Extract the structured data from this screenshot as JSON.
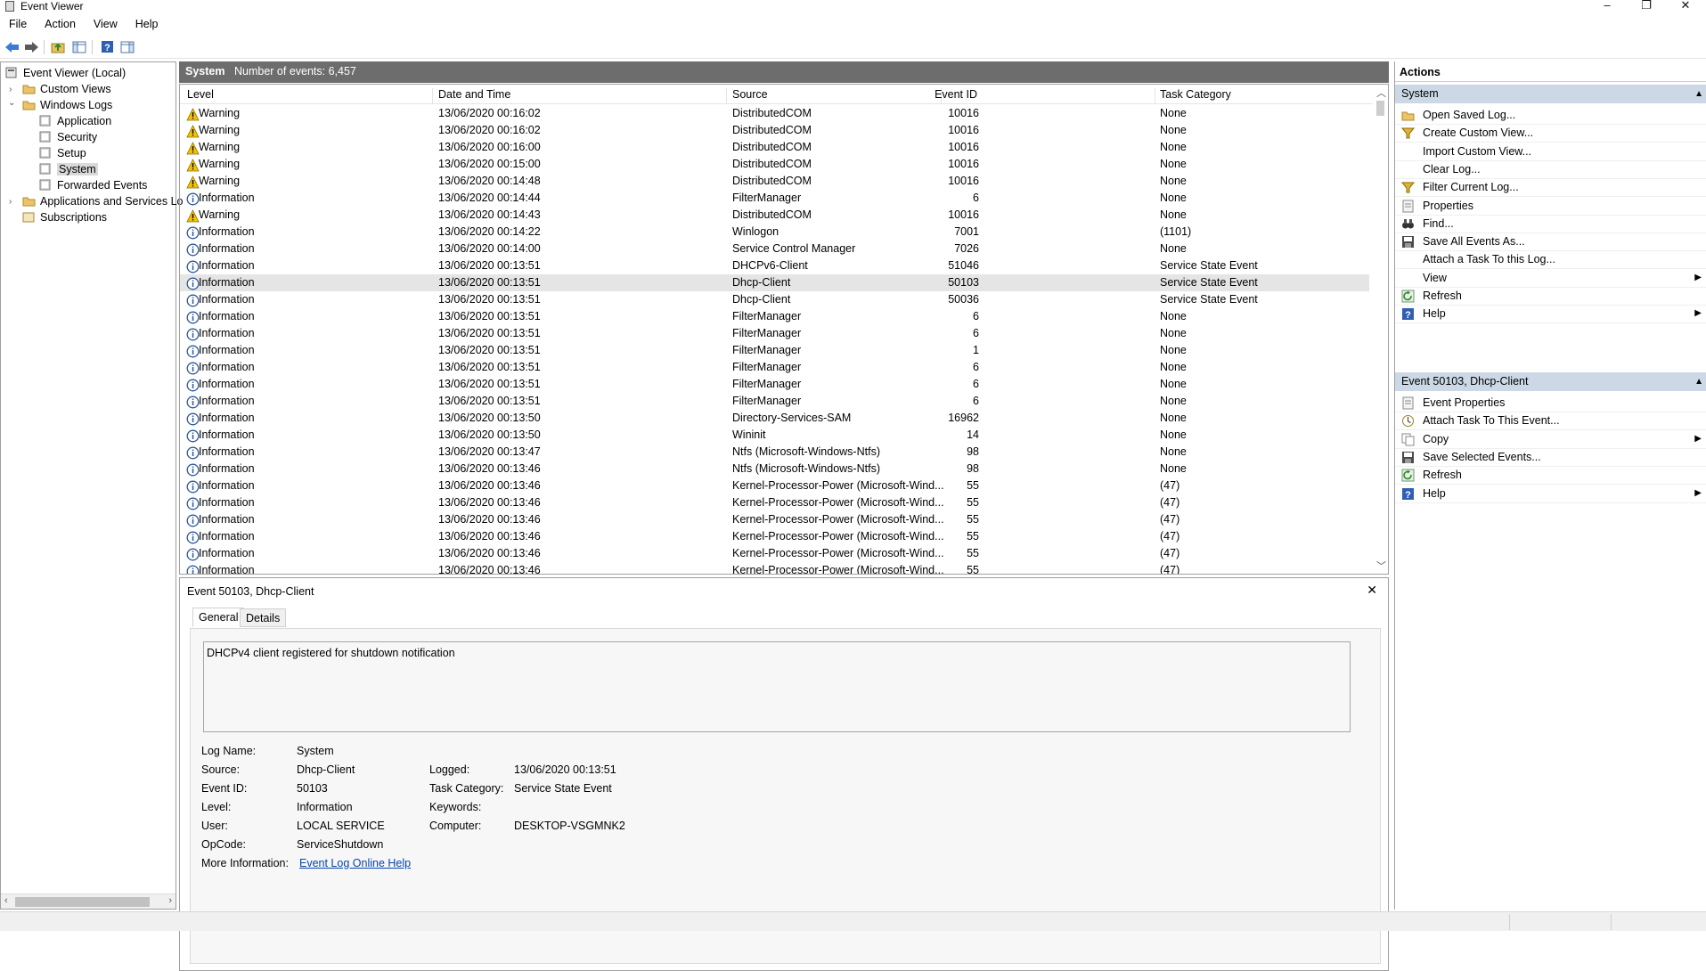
{
  "window": {
    "title": "Event Viewer",
    "minimize": "–",
    "restore": "❐",
    "close": "✕"
  },
  "menu": [
    "File",
    "Action",
    "View",
    "Help"
  ],
  "toolbar": [
    "back-icon",
    "forward-icon",
    "up-folder-icon",
    "show-hide-tree-icon",
    "help-icon",
    "show-hide-action-pane-icon"
  ],
  "tree": {
    "root": "Event Viewer (Local)",
    "custom_views": "Custom Views",
    "windows_logs": "Windows Logs",
    "logs": [
      "Application",
      "Security",
      "Setup",
      "System",
      "Forwarded Events"
    ],
    "apps_services": "Applications and Services Lo",
    "subscriptions": "Subscriptions",
    "selected": "System"
  },
  "center": {
    "log_name": "System",
    "event_count": "Number of events: 6,457",
    "columns": [
      "Level",
      "Date and Time",
      "Source",
      "Event ID",
      "Task Category"
    ],
    "rows": [
      [
        "Warning",
        "13/06/2020 00:16:02",
        "DistributedCOM",
        "10016",
        "None"
      ],
      [
        "Warning",
        "13/06/2020 00:16:02",
        "DistributedCOM",
        "10016",
        "None"
      ],
      [
        "Warning",
        "13/06/2020 00:16:00",
        "DistributedCOM",
        "10016",
        "None"
      ],
      [
        "Warning",
        "13/06/2020 00:15:00",
        "DistributedCOM",
        "10016",
        "None"
      ],
      [
        "Warning",
        "13/06/2020 00:14:48",
        "DistributedCOM",
        "10016",
        "None"
      ],
      [
        "Information",
        "13/06/2020 00:14:44",
        "FilterManager",
        "6",
        "None"
      ],
      [
        "Warning",
        "13/06/2020 00:14:43",
        "DistributedCOM",
        "10016",
        "None"
      ],
      [
        "Information",
        "13/06/2020 00:14:22",
        "Winlogon",
        "7001",
        "(1101)"
      ],
      [
        "Information",
        "13/06/2020 00:14:00",
        "Service Control Manager",
        "7026",
        "None"
      ],
      [
        "Information",
        "13/06/2020 00:13:51",
        "DHCPv6-Client",
        "51046",
        "Service State Event"
      ],
      [
        "Information",
        "13/06/2020 00:13:51",
        "Dhcp-Client",
        "50103",
        "Service State Event"
      ],
      [
        "Information",
        "13/06/2020 00:13:51",
        "Dhcp-Client",
        "50036",
        "Service State Event"
      ],
      [
        "Information",
        "13/06/2020 00:13:51",
        "FilterManager",
        "6",
        "None"
      ],
      [
        "Information",
        "13/06/2020 00:13:51",
        "FilterManager",
        "6",
        "None"
      ],
      [
        "Information",
        "13/06/2020 00:13:51",
        "FilterManager",
        "1",
        "None"
      ],
      [
        "Information",
        "13/06/2020 00:13:51",
        "FilterManager",
        "6",
        "None"
      ],
      [
        "Information",
        "13/06/2020 00:13:51",
        "FilterManager",
        "6",
        "None"
      ],
      [
        "Information",
        "13/06/2020 00:13:51",
        "FilterManager",
        "6",
        "None"
      ],
      [
        "Information",
        "13/06/2020 00:13:50",
        "Directory-Services-SAM",
        "16962",
        "None"
      ],
      [
        "Information",
        "13/06/2020 00:13:50",
        "Wininit",
        "14",
        "None"
      ],
      [
        "Information",
        "13/06/2020 00:13:47",
        "Ntfs (Microsoft-Windows-Ntfs)",
        "98",
        "None"
      ],
      [
        "Information",
        "13/06/2020 00:13:46",
        "Ntfs (Microsoft-Windows-Ntfs)",
        "98",
        "None"
      ],
      [
        "Information",
        "13/06/2020 00:13:46",
        "Kernel-Processor-Power (Microsoft-Wind...",
        "55",
        "(47)"
      ],
      [
        "Information",
        "13/06/2020 00:13:46",
        "Kernel-Processor-Power (Microsoft-Wind...",
        "55",
        "(47)"
      ],
      [
        "Information",
        "13/06/2020 00:13:46",
        "Kernel-Processor-Power (Microsoft-Wind...",
        "55",
        "(47)"
      ],
      [
        "Information",
        "13/06/2020 00:13:46",
        "Kernel-Processor-Power (Microsoft-Wind...",
        "55",
        "(47)"
      ],
      [
        "Information",
        "13/06/2020 00:13:46",
        "Kernel-Processor-Power (Microsoft-Wind...",
        "55",
        "(47)"
      ],
      [
        "Information",
        "13/06/2020 00:13:46",
        "Kernel-Processor-Power (Microsoft-Wind...",
        "55",
        "(47)"
      ]
    ],
    "selected_row": 10
  },
  "detail": {
    "title": "Event 50103, Dhcp-Client",
    "close": "✕",
    "tabs": [
      "General",
      "Details"
    ],
    "description": "DHCPv4 client registered for shutdown notification",
    "fields": {
      "log_name_label": "Log Name:",
      "log_name": "System",
      "source_label": "Source:",
      "source": "Dhcp-Client",
      "event_id_label": "Event ID:",
      "event_id": "50103",
      "level_label": "Level:",
      "level": "Information",
      "user_label": "User:",
      "user": "LOCAL SERVICE",
      "opcode_label": "OpCode:",
      "opcode": "ServiceShutdown",
      "more_info_label": "More Information:",
      "more_info_link": "Event Log Online Help",
      "logged_label": "Logged:",
      "logged": "13/06/2020 00:13:51",
      "task_category_label": "Task Category:",
      "task_category": "Service State Event",
      "keywords_label": "Keywords:",
      "keywords": "",
      "computer_label": "Computer:",
      "computer": "DESKTOP-VSGMNK2"
    }
  },
  "actions": {
    "title": "Actions",
    "section1": "System",
    "section1_items": [
      {
        "label": "Open Saved Log...",
        "icon": "open-folder-icon"
      },
      {
        "label": "Create Custom View...",
        "icon": "filter-icon"
      },
      {
        "label": "Import Custom View...",
        "icon": ""
      },
      {
        "label": "Clear Log...",
        "icon": ""
      },
      {
        "label": "Filter Current Log...",
        "icon": "filter-icon"
      },
      {
        "label": "Properties",
        "icon": "properties-icon"
      },
      {
        "label": "Find...",
        "icon": "binoculars-icon"
      },
      {
        "label": "Save All Events As...",
        "icon": "save-icon"
      },
      {
        "label": "Attach a Task To this Log...",
        "icon": ""
      },
      {
        "label": "View",
        "icon": "",
        "submenu": true
      },
      {
        "label": "Refresh",
        "icon": "refresh-icon"
      },
      {
        "label": "Help",
        "icon": "help-icon",
        "submenu": true
      }
    ],
    "section2": "Event 50103, Dhcp-Client",
    "section2_items": [
      {
        "label": "Event Properties",
        "icon": "properties-icon"
      },
      {
        "label": "Attach Task To This Event...",
        "icon": "task-icon"
      },
      {
        "label": "Copy",
        "icon": "copy-icon",
        "submenu": true
      },
      {
        "label": "Save Selected Events...",
        "icon": "save-icon"
      },
      {
        "label": "Refresh",
        "icon": "refresh-icon"
      },
      {
        "label": "Help",
        "icon": "help-icon",
        "submenu": true
      }
    ]
  },
  "colors": {
    "warning": "#f5c400",
    "info": "#2b5797",
    "header_bg": "#6d6d6d",
    "section_bg": "#ccd8e6",
    "link": "#0645ad"
  }
}
